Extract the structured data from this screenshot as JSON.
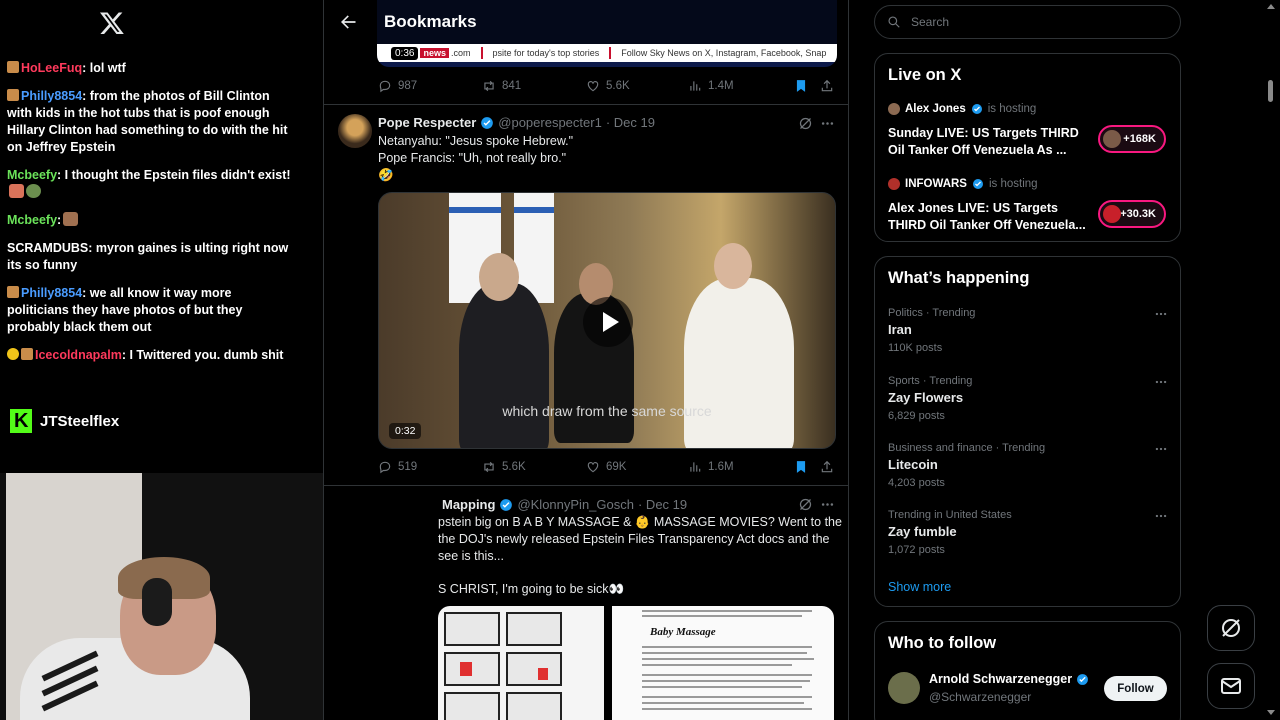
{
  "stream_chat": {
    "messages": [
      {
        "user": "HoLeeFuq",
        "user_color": "#ff3a5c",
        "text": ": lol wtf",
        "badge": true
      },
      {
        "user": "Philly8854",
        "user_color": "#4a9cff",
        "text": ": from the photos of Bill Clinton with kids in the hot tubs that is poof enough Hillary Clinton had something to do with the hit on Jeffrey Epstein",
        "badge": true
      },
      {
        "user": "Mcbeefy",
        "user_color": "#6be35a",
        "text": ": I thought the Epstein files didn't exist!",
        "emotes": [
          "a",
          "b"
        ]
      },
      {
        "user": "Mcbeefy",
        "user_color": "#6be35a",
        "text": ":",
        "emotes": [
          "c"
        ]
      },
      {
        "user": "SCRAMDUBS",
        "user_color": "#ffffff",
        "text": ": myron gaines is ulting right now its so funny"
      },
      {
        "user": "Philly8854",
        "user_color": "#4a9cff",
        "text": ": we all know it way more politicians they have photos of but they probably black them out",
        "badge": true
      },
      {
        "user": "Icecoldnapalm",
        "user_color": "#ff3a5c",
        "text": ": I Twittered you. dumb shit",
        "badge": true,
        "badge_alt": true
      }
    ],
    "streamer_name": "JTSteelflex"
  },
  "main": {
    "title": "Bookmarks",
    "top_video": {
      "time": "0:36",
      "ticker_brand": "news",
      "ticker_brand_suffix": ".com",
      "ticker_text_1": "psite for today's top stories",
      "ticker_text_2": "Follow Sky News on X, Instagram, Facebook, Snap"
    },
    "top_actions": {
      "replies": "987",
      "reposts": "841",
      "likes": "5.6K",
      "views": "1.4M"
    },
    "tweet1": {
      "name": "Pope Respecter",
      "handle": "@poperespecter1",
      "date": "· Dec 19",
      "line1": "Netanyahu: \"Jesus spoke Hebrew.\"",
      "line2": "Pope Francis: \"Uh, not really bro.\"",
      "line3": "🤣",
      "subtitle": "which draw from the same source",
      "video_time": "0:32",
      "actions": {
        "replies": "519",
        "reposts": "5.6K",
        "likes": "69K",
        "views": "1.6M"
      }
    },
    "tweet2": {
      "name": "Mapping",
      "handle": "@KlonnyPin_Gosch",
      "date": "· Dec 19",
      "line1": "pstein big on  B A B Y  MASSAGE  & 👶 MASSAGE MOVIES? Went to the",
      "line2": " the DOJ's newly released Epstein Files Transparency Act docs and the",
      "line3": " see is this...",
      "line4": "S CHRIST, I'm going to be sick👀",
      "doc_title": "Baby Massage"
    }
  },
  "sidebar": {
    "search_placeholder": "Search",
    "live": {
      "title": "Live on X",
      "items": [
        {
          "host": "Alex Jones",
          "hosting": "is hosting",
          "title": "Sunday LIVE: US Targets THIRD Oil Tanker Off Venezuela As ...",
          "count": "+168K"
        },
        {
          "host": "INFOWARS",
          "hosting": "is hosting",
          "title": "Alex Jones LIVE: US Targets THIRD Oil Tanker Off Venezuela...",
          "count": "+30.3K"
        }
      ]
    },
    "happening": {
      "title": "What’s happening",
      "trends": [
        {
          "category": "Politics · Trending",
          "topic": "Iran",
          "posts": "110K posts"
        },
        {
          "category": "Sports · Trending",
          "topic": "Zay Flowers",
          "posts": "6,829 posts"
        },
        {
          "category": "Business and finance · Trending",
          "topic": "Litecoin",
          "posts": "4,203 posts"
        },
        {
          "category": "Trending in United States",
          "topic": "Zay fumble",
          "posts": "1,072 posts"
        }
      ],
      "show_more": "Show more"
    },
    "who_to_follow": {
      "title": "Who to follow",
      "name": "Arnold Schwarzenegger",
      "handle": "@Schwarzenegger",
      "button": "Follow"
    }
  },
  "colors": {
    "accent": "#1d9bf0",
    "live": "#f91880",
    "background": "#000000",
    "border": "#2f3336"
  }
}
